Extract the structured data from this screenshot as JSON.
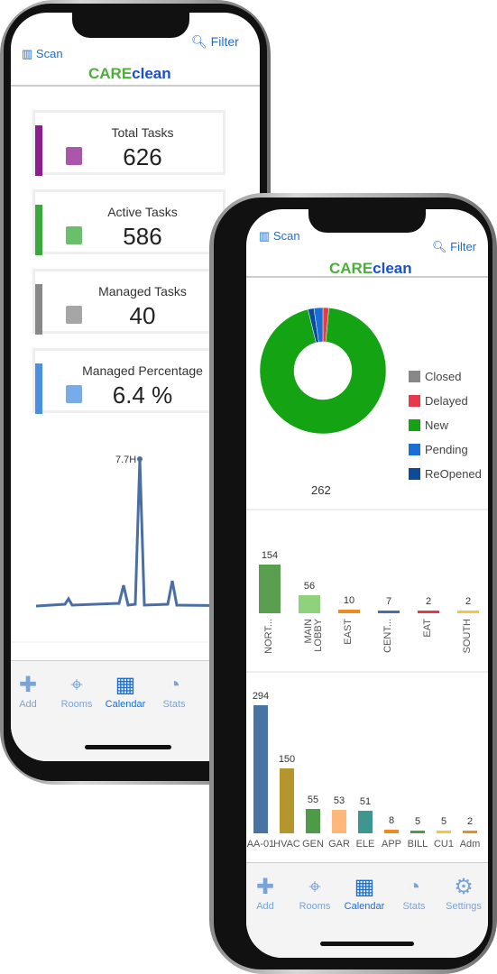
{
  "back_phone": {
    "header": {
      "scan_label": "Scan",
      "filter_label": "Filter",
      "logo_care": "CARE",
      "logo_clean": "clean"
    },
    "cards": [
      {
        "title": "Total Tasks",
        "value": "626",
        "color": "#8e1e8e",
        "icon": "task-tray-icon"
      },
      {
        "title": "Active Tasks",
        "value": "586",
        "color": "#3aa83a",
        "icon": "calendar-icon"
      },
      {
        "title": "Managed Tasks",
        "value": "40",
        "color": "#888888",
        "icon": "checklist-icon"
      },
      {
        "title": "Managed Percentage",
        "value": "6.4 %",
        "color": "#4a90e2",
        "icon": "growth-chart-icon"
      }
    ],
    "line_chart": {
      "peak_label": "7.7H",
      "color": "#4a6fa5"
    },
    "tabs": [
      {
        "label": "Add",
        "icon": "plus-icon"
      },
      {
        "label": "Rooms",
        "icon": "location-pin-icon"
      },
      {
        "label": "Calendar",
        "icon": "calendar-icon",
        "active": true
      },
      {
        "label": "Stats",
        "icon": "pie-chart-icon"
      }
    ]
  },
  "front_phone": {
    "header": {
      "scan_label": "Scan",
      "filter_label": "Filter",
      "logo_care": "CARE",
      "logo_clean": "clean"
    },
    "chart_data": [
      {
        "type": "pie",
        "donut": true,
        "total_label": "262",
        "categories": [
          "Closed",
          "Delayed",
          "New",
          "Pending",
          "ReOpened"
        ],
        "colors": [
          "#888888",
          "#e8394a",
          "#13a313",
          "#1a6fd6",
          "#0d4a9c"
        ],
        "values": [
          0,
          4,
          248,
          6,
          4
        ]
      },
      {
        "type": "bar",
        "categories": [
          "NORT...",
          "MAIN LOBBY",
          "EAST",
          "CENT...",
          "EAT",
          "SOUTH"
        ],
        "values": [
          154,
          56,
          10,
          7,
          2,
          2
        ],
        "colors": [
          "#5a9e4f",
          "#8fd17d",
          "#f08a24",
          "#4a6fa5",
          "#e8394a",
          "#f5c542"
        ]
      },
      {
        "type": "bar",
        "categories": [
          "AA-01",
          "HVAC",
          "GEN",
          "GAR",
          "ELE",
          "APP",
          "BILL",
          "CU1",
          "Adm"
        ],
        "values": [
          294,
          150,
          55,
          53,
          51,
          8,
          5,
          5,
          2
        ],
        "colors": [
          "#4a73a5",
          "#b5952d",
          "#4f9a47",
          "#fdb87a",
          "#3f968f",
          "#f08a24",
          "#4f9a47",
          "#f5c542",
          "#f08a24"
        ]
      }
    ],
    "tabs": [
      {
        "label": "Add",
        "icon": "plus-icon"
      },
      {
        "label": "Rooms",
        "icon": "location-pin-icon"
      },
      {
        "label": "Calendar",
        "icon": "calendar-icon",
        "active": true
      },
      {
        "label": "Stats",
        "icon": "pie-chart-icon"
      },
      {
        "label": "Settings",
        "icon": "gear-icon"
      }
    ]
  }
}
